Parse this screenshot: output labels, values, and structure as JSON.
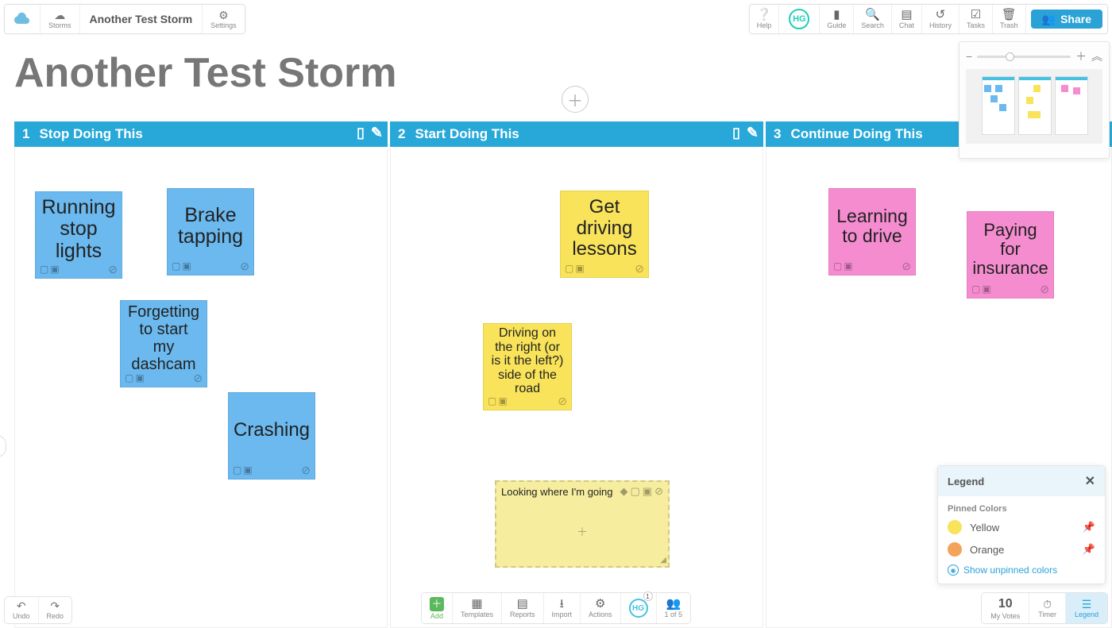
{
  "app": {
    "storms_label": "Storms",
    "title": "Another Test Storm",
    "settings_label": "Settings"
  },
  "top_right": {
    "help": "Help",
    "avatar": "HG",
    "guide": "Guide",
    "search": "Search",
    "chat": "Chat",
    "history": "History",
    "tasks": "Tasks",
    "trash": "Trash",
    "share": "Share"
  },
  "board": {
    "title": "Another Test Storm"
  },
  "columns": [
    {
      "num": "1",
      "title": "Stop Doing This"
    },
    {
      "num": "2",
      "title": "Start Doing This"
    },
    {
      "num": "3",
      "title": "Continue Doing This"
    }
  ],
  "notes": {
    "c1": [
      {
        "text": "Running stop lights"
      },
      {
        "text": "Brake tapping"
      },
      {
        "text": "Forgetting to start my dashcam"
      },
      {
        "text": "Crashing"
      }
    ],
    "c2": [
      {
        "text": "Get driving lessons"
      },
      {
        "text": "Driving on the right (or is it the left?) side of the road"
      }
    ],
    "c2_editing": {
      "title": "Looking where I'm going"
    },
    "c3": [
      {
        "text": "Learning to drive"
      },
      {
        "text": "Paying for insurance"
      }
    ]
  },
  "bottom_left": {
    "undo": "Undo",
    "redo": "Redo"
  },
  "center_tray": {
    "add": "Add",
    "templates": "Templates",
    "reports": "Reports",
    "import": "Import",
    "actions": "Actions",
    "avatar": "HG",
    "badge": "1",
    "people_count": "1 of 5"
  },
  "bottom_right": {
    "votes_num": "10",
    "votes": "My Votes",
    "timer": "Timer",
    "legend": "Legend"
  },
  "legend": {
    "title": "Legend",
    "subtitle": "Pinned Colors",
    "rows": [
      {
        "name": "Yellow",
        "hex": "#f8e35a"
      },
      {
        "name": "Orange",
        "hex": "#f3a35a"
      }
    ],
    "show_unpinned": "Show unpinned colors"
  }
}
